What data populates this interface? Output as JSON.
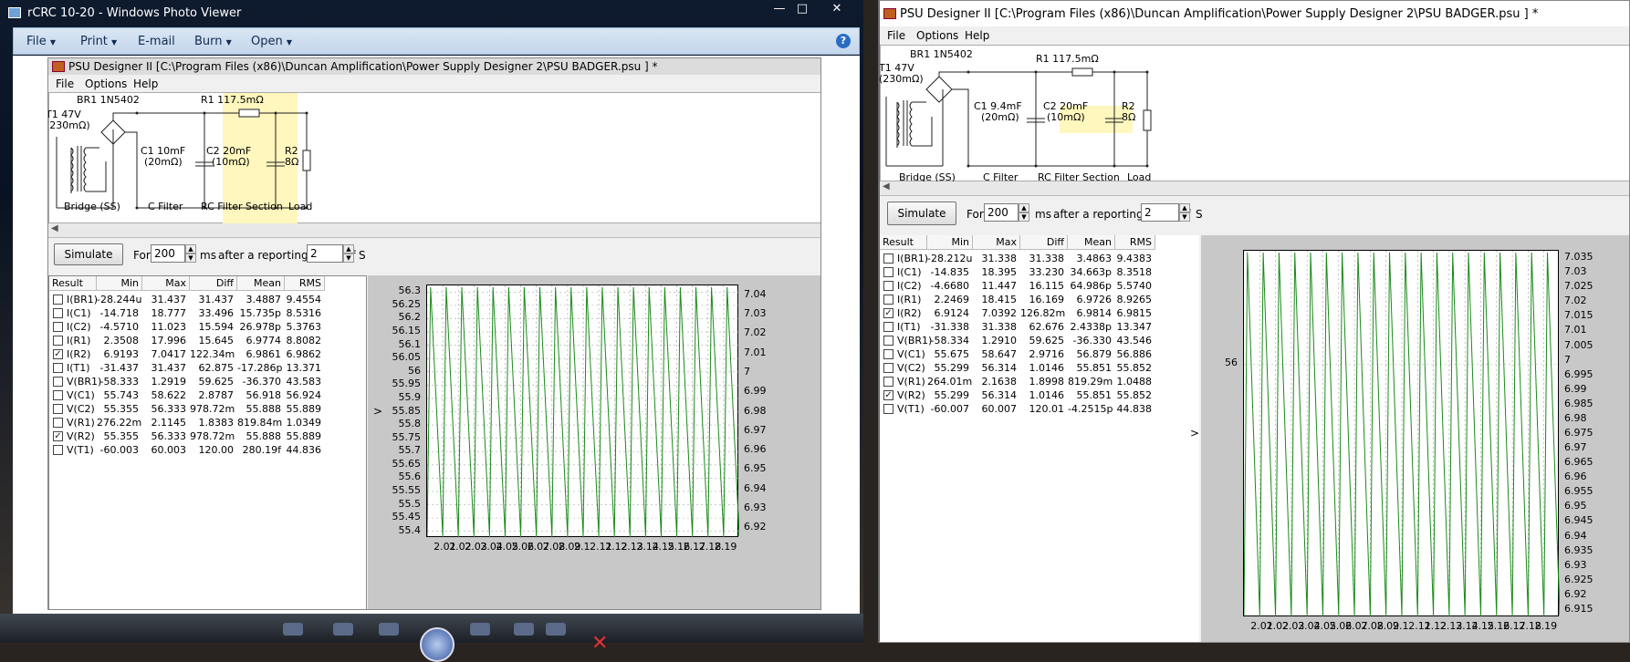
{
  "photo_viewer": {
    "title": "rCRC 10-20 - Windows Photo Viewer",
    "window_controls": {
      "minimize": "—",
      "maximize": "□",
      "close": "✕"
    },
    "menu": [
      {
        "label": "File",
        "arrow": "▼"
      },
      {
        "label": "Print",
        "arrow": "▼"
      },
      {
        "label": "E-mail",
        "arrow": ""
      },
      {
        "label": "Burn",
        "arrow": "▼"
      },
      {
        "label": "Open",
        "arrow": "▼"
      }
    ],
    "help": "?"
  },
  "left": {
    "title": "PSU Designer II  [C:\\Program Files (x86)\\Duncan Amplification\\Power Supply Designer 2\\PSU BADGER.psu ] *",
    "menu": [
      "File",
      "Options",
      "Help"
    ],
    "schematic": {
      "br1": "BR1 1N5402",
      "t1": "T1 47V",
      "t1_r": "(230mΩ)",
      "r1": "R1 117.5mΩ",
      "c1": "C1 10mF",
      "c1_r": "(20mΩ)",
      "c2": "C2 20mF",
      "c2_r": "(10mΩ)",
      "r2": "R2",
      "r2_v": "8Ω",
      "sections": [
        "Bridge (SS)",
        "C Filter",
        "RC Filter Section",
        "Load"
      ]
    },
    "controls": {
      "simulate": "Simulate",
      "for": "For",
      "for_value": "200",
      "ms": "ms",
      "delay_label": "after a reporting delay of",
      "delay_value": "2",
      "s": "S"
    },
    "headers": [
      "Result",
      "Min",
      "Max",
      "Diff",
      "Mean",
      "RMS"
    ],
    "rows": [
      {
        "name": "I(BR1)",
        "checked": false,
        "min": "-28.244u",
        "max": "31.437",
        "diff": "31.437",
        "mean": "3.4887",
        "rms": "9.4554"
      },
      {
        "name": "I(C1)",
        "checked": false,
        "min": "-14.718",
        "max": "18.777",
        "diff": "33.496",
        "mean": "15.735p",
        "rms": "8.5316"
      },
      {
        "name": "I(C2)",
        "checked": false,
        "min": "-4.5710",
        "max": "11.023",
        "diff": "15.594",
        "mean": "26.978p",
        "rms": "5.3763"
      },
      {
        "name": "I(R1)",
        "checked": false,
        "min": "2.3508",
        "max": "17.996",
        "diff": "15.645",
        "mean": "6.9774",
        "rms": "8.8082"
      },
      {
        "name": "I(R2)",
        "checked": true,
        "min": "6.9193",
        "max": "7.0417",
        "diff": "122.34m",
        "mean": "6.9861",
        "rms": "6.9862"
      },
      {
        "name": "I(T1)",
        "checked": false,
        "min": "-31.437",
        "max": "31.437",
        "diff": "62.875",
        "mean": "-17.286p",
        "rms": "13.371"
      },
      {
        "name": "V(BR1)",
        "checked": false,
        "min": "-58.333",
        "max": "1.2919",
        "diff": "59.625",
        "mean": "-36.370",
        "rms": "43.583"
      },
      {
        "name": "V(C1)",
        "checked": false,
        "min": "55.743",
        "max": "58.622",
        "diff": "2.8787",
        "mean": "56.918",
        "rms": "56.924"
      },
      {
        "name": "V(C2)",
        "checked": false,
        "min": "55.355",
        "max": "56.333",
        "diff": "978.72m",
        "mean": "55.888",
        "rms": "55.889"
      },
      {
        "name": "V(R1)",
        "checked": false,
        "min": "276.22m",
        "max": "2.1145",
        "diff": "1.8383",
        "mean": "819.84m",
        "rms": "1.0349"
      },
      {
        "name": "V(R2)",
        "checked": true,
        "min": "55.355",
        "max": "56.333",
        "diff": "978.72m",
        "mean": "55.888",
        "rms": "55.889"
      },
      {
        "name": "V(T1)",
        "checked": false,
        "min": "-60.003",
        "max": "60.003",
        "diff": "120.00",
        "mean": "280.19f",
        "rms": "44.836"
      }
    ],
    "chart_marker": ">"
  },
  "right": {
    "title": "PSU Designer II  [C:\\Program Files (x86)\\Duncan Amplification\\Power Supply Designer 2\\PSU BADGER.psu ] *",
    "menu": [
      "File",
      "Options",
      "Help"
    ],
    "schematic": {
      "br1": "BR1 1N5402",
      "t1": "T1 47V",
      "t1_r": "(230mΩ)",
      "r1": "R1 117.5mΩ",
      "c1": "C1 9.4mF",
      "c1_r": "(20mΩ)",
      "c2": "C2 20mF",
      "c2_r": "(10mΩ)",
      "r2": "R2",
      "r2_v": "8Ω",
      "sections": [
        "Bridge (SS)",
        "C Filter",
        "RC Filter Section",
        "Load"
      ]
    },
    "controls": {
      "simulate": "Simulate",
      "for": "For",
      "for_value": "200",
      "ms": "ms",
      "delay_label": "after a reporting delay of",
      "delay_value": "2",
      "s": "S"
    },
    "headers": [
      "Result",
      "Min",
      "Max",
      "Diff",
      "Mean",
      "RMS"
    ],
    "rows": [
      {
        "name": "I(BR1)",
        "checked": false,
        "min": "-28.212u",
        "max": "31.338",
        "diff": "31.338",
        "mean": "3.4863",
        "rms": "9.4383"
      },
      {
        "name": "I(C1)",
        "checked": false,
        "min": "-14.835",
        "max": "18.395",
        "diff": "33.230",
        "mean": "34.663p",
        "rms": "8.3518"
      },
      {
        "name": "I(C2)",
        "checked": false,
        "min": "-4.6680",
        "max": "11.447",
        "diff": "16.115",
        "mean": "64.986p",
        "rms": "5.5740"
      },
      {
        "name": "I(R1)",
        "checked": false,
        "min": "2.2469",
        "max": "18.415",
        "diff": "16.169",
        "mean": "6.9726",
        "rms": "8.9265"
      },
      {
        "name": "I(R2)",
        "checked": true,
        "min": "6.9124",
        "max": "7.0392",
        "diff": "126.82m",
        "mean": "6.9814",
        "rms": "6.9815"
      },
      {
        "name": "I(T1)",
        "checked": false,
        "min": "-31.338",
        "max": "31.338",
        "diff": "62.676",
        "mean": "2.4338p",
        "rms": "13.347"
      },
      {
        "name": "V(BR1)",
        "checked": false,
        "min": "-58.334",
        "max": "1.2910",
        "diff": "59.625",
        "mean": "-36.330",
        "rms": "43.546"
      },
      {
        "name": "V(C1)",
        "checked": false,
        "min": "55.675",
        "max": "58.647",
        "diff": "2.9716",
        "mean": "56.879",
        "rms": "56.886"
      },
      {
        "name": "V(C2)",
        "checked": false,
        "min": "55.299",
        "max": "56.314",
        "diff": "1.0146",
        "mean": "55.851",
        "rms": "55.852"
      },
      {
        "name": "V(R1)",
        "checked": false,
        "min": "264.01m",
        "max": "2.1638",
        "diff": "1.8998",
        "mean": "819.29m",
        "rms": "1.0488"
      },
      {
        "name": "V(R2)",
        "checked": true,
        "min": "55.299",
        "max": "56.314",
        "diff": "1.0146",
        "mean": "55.851",
        "rms": "55.852"
      },
      {
        "name": "V(T1)",
        "checked": false,
        "min": "-60.007",
        "max": "60.007",
        "diff": "120.01",
        "mean": "-4.2515p",
        "rms": "44.838"
      }
    ],
    "chart_marker": ">"
  },
  "chart_data": [
    {
      "type": "line",
      "x_ticks": [
        "2.01",
        "2.02",
        "2.03",
        "2.04",
        "2.05",
        "2.06",
        "2.07",
        "2.08",
        "2.09",
        "2.1",
        "2.11",
        "2.12",
        "2.13",
        "2.14",
        "2.15",
        "2.16",
        "2.17",
        "2.18",
        "2.19"
      ],
      "xlim": [
        2.0,
        2.2
      ],
      "y_left_ticks": [
        "56.3",
        "56.25",
        "56.2",
        "56.15",
        "56.1",
        "56.05",
        "56",
        "55.95",
        "55.9",
        "55.85",
        "55.8",
        "55.75",
        "55.7",
        "55.65",
        "55.6",
        "55.55",
        "55.5",
        "55.45",
        "55.4"
      ],
      "ylim_left": [
        55.355,
        56.333
      ],
      "y_right_ticks": [
        "7.04",
        "7.03",
        "7.02",
        "7.01",
        "7",
        "6.99",
        "6.98",
        "6.97",
        "6.96",
        "6.95",
        "6.94",
        "6.93",
        "6.92"
      ],
      "ylim_right": [
        6.9193,
        7.0417
      ],
      "ripple_frequency_hz": 100,
      "color": "#1a8a1a"
    },
    {
      "type": "line",
      "x_ticks": [
        "2.01",
        "2.02",
        "2.03",
        "2.04",
        "2.05",
        "2.06",
        "2.07",
        "2.08",
        "2.09",
        "2.1",
        "2.11",
        "2.12",
        "2.13",
        "2.14",
        "2.15",
        "2.16",
        "2.17",
        "2.18",
        "2.19"
      ],
      "xlim": [
        2.0,
        2.2
      ],
      "y_left_ticks": [
        "56"
      ],
      "ylim_left": [
        55.299,
        56.314
      ],
      "y_right_ticks": [
        "7.035",
        "7.03",
        "7.025",
        "7.02",
        "7.015",
        "7.01",
        "7.005",
        "7",
        "6.995",
        "6.99",
        "6.985",
        "6.98",
        "6.975",
        "6.97",
        "6.965",
        "6.96",
        "6.955",
        "6.95",
        "6.945",
        "6.94",
        "6.935",
        "6.93",
        "6.925",
        "6.92",
        "6.915"
      ],
      "ylim_right": [
        6.9124,
        7.0392
      ],
      "ripple_frequency_hz": 100,
      "color": "#1a8a1a"
    }
  ]
}
